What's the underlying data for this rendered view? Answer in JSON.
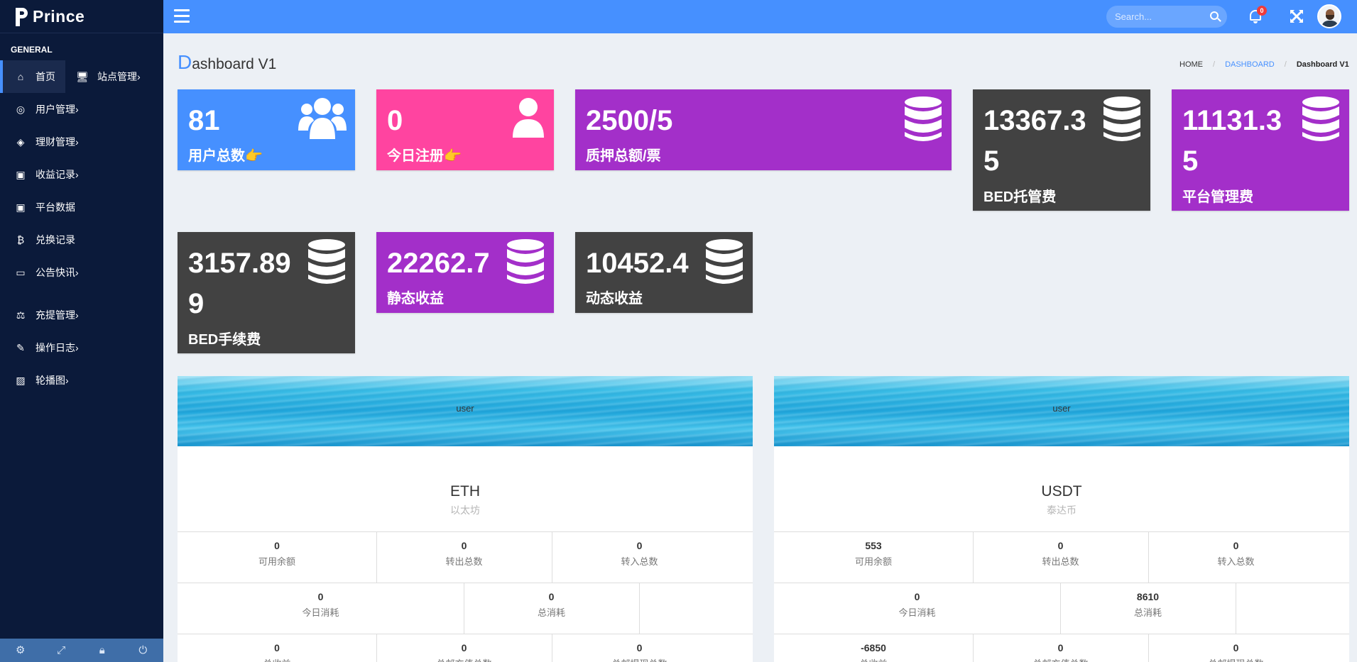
{
  "sidebar": {
    "brand": "Prince",
    "section": "GENERAL",
    "items": [
      {
        "label": "首页"
      },
      {
        "label": "站点管理"
      },
      {
        "label": "用户管理"
      },
      {
        "label": "理财管理"
      },
      {
        "label": "收益记录"
      },
      {
        "label": "平台数据"
      },
      {
        "label": "兑换记录"
      },
      {
        "label": "公告快讯"
      },
      {
        "label": "充提管理"
      },
      {
        "label": "操作日志"
      },
      {
        "label": "轮播图"
      }
    ],
    "footer_icons": [
      "gear-icon",
      "expand-icon",
      "lock-icon",
      "power-icon"
    ]
  },
  "topbar": {
    "search_placeholder": "Search...",
    "notification_count": "0"
  },
  "header": {
    "title_first": "D",
    "title_rest": "ashboard V1",
    "breadcrumb": [
      "HOME",
      "DASHBOARD",
      "Dashboard V1"
    ]
  },
  "stats": [
    {
      "value": "81",
      "label": "用户总数👉",
      "color": "#4690ff",
      "icon": "users-icon"
    },
    {
      "value": "0",
      "label": "今日注册👉",
      "color": "#ff44a0",
      "icon": "user-icon"
    },
    {
      "value": "2500/5",
      "label": "质押总额/票",
      "color": "#a32fc9",
      "icon": "database-icon"
    },
    {
      "value": "13367.3",
      "value2": "5",
      "label": "BED托管费",
      "color": "#424242",
      "icon": "database-icon"
    },
    {
      "value": "11131.3",
      "value2": "5",
      "label": "平台管理费",
      "color": "#a32fc9",
      "icon": "database-icon"
    },
    {
      "value": "3157.89",
      "value2": "9",
      "label": "BED手续费",
      "color": "#424242",
      "icon": "database-icon"
    },
    {
      "value": "22262.7",
      "label": "静态收益",
      "color": "#a32fc9",
      "icon": "database-icon"
    },
    {
      "value": "10452.4",
      "label": "动态收益",
      "color": "#424242",
      "icon": "database-icon"
    }
  ],
  "panels": [
    {
      "banner": "user",
      "coin": "ETH",
      "coin_sub": "以太坊",
      "row1": [
        {
          "n": "0",
          "t": "可用余额"
        },
        {
          "n": "0",
          "t": "转出总数"
        },
        {
          "n": "0",
          "t": "转入总数"
        }
      ],
      "row2": [
        {
          "n": "0",
          "t": "今日消耗"
        },
        {
          "n": "0",
          "t": "总消耗"
        }
      ],
      "row3": [
        {
          "n": "0",
          "t": "总收益"
        },
        {
          "n": "0",
          "t": "总邮充值总数"
        },
        {
          "n": "0",
          "t": "总邮提现总数"
        }
      ]
    },
    {
      "banner": "user",
      "coin": "USDT",
      "coin_sub": "泰达币",
      "row1": [
        {
          "n": "553",
          "t": "可用余额"
        },
        {
          "n": "0",
          "t": "转出总数"
        },
        {
          "n": "0",
          "t": "转入总数"
        }
      ],
      "row2": [
        {
          "n": "0",
          "t": "今日消耗"
        },
        {
          "n": "8610",
          "t": "总消耗"
        }
      ],
      "row3": [
        {
          "n": "-6850",
          "t": "总收益"
        },
        {
          "n": "0",
          "t": "总邮充值总数"
        },
        {
          "n": "0",
          "t": "总邮提现总数"
        }
      ]
    }
  ]
}
